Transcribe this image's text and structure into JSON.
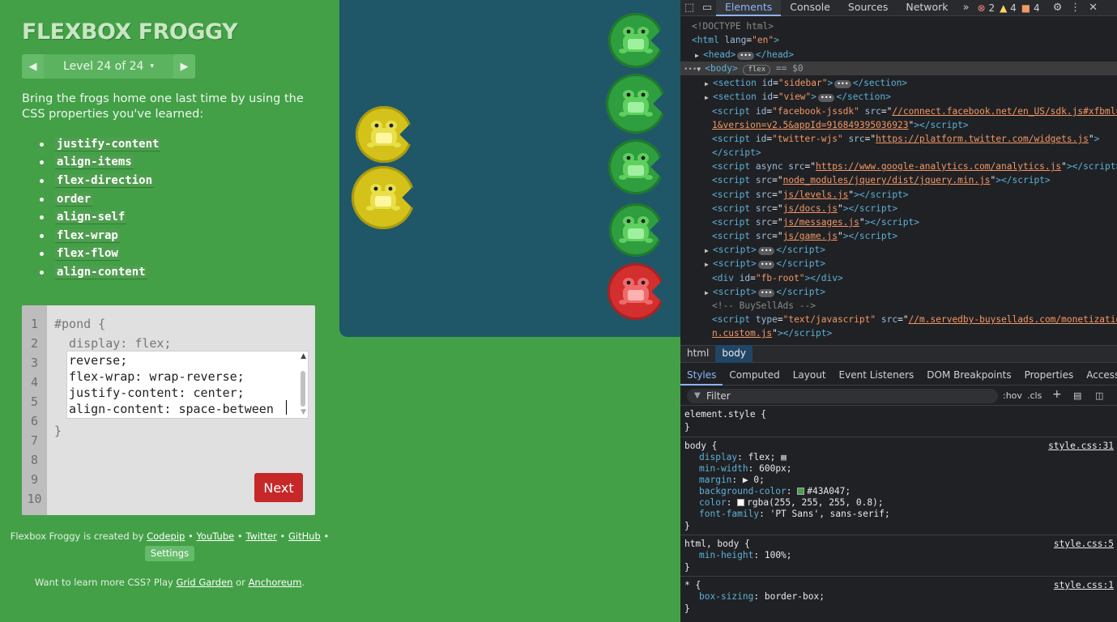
{
  "sidebar": {
    "logo": "FLEXBOX FROGGY",
    "level_label": "Level 24 of 24",
    "level_caret": "▾",
    "prev_arrow": "◀",
    "next_arrow": "▶",
    "instructions": "Bring the frogs home one last time by using the CSS properties you've learned:",
    "properties": [
      "justify-content",
      "align-items",
      "flex-direction",
      "order",
      "align-self",
      "flex-wrap",
      "flex-flow",
      "align-content"
    ]
  },
  "editor": {
    "line_numbers": [
      "1",
      "2",
      "3",
      "4",
      "5",
      "6",
      "7",
      "8",
      "9",
      "10"
    ],
    "line1": "#pond {",
    "line2": "  display: flex;",
    "closing": "}",
    "input_lines": [
      "reverse;",
      "flex-wrap: wrap-reverse;",
      "justify-content: center;",
      "align-content: space-between"
    ],
    "next_label": "Next"
  },
  "credits": {
    "prefix": "Flexbox Froggy is created by ",
    "codepip": "Codepip",
    "sep": " • ",
    "youtube": "YouTube",
    "twitter": "Twitter",
    "github": "GitHub",
    "settings": "Settings"
  },
  "promo": {
    "prefix": "Want to learn more CSS? Play ",
    "grid_garden": "Grid Garden",
    "or": " or ",
    "anchoreum": "Anchoreum",
    "suffix": "."
  },
  "pond": {
    "background": "#1f5768",
    "items": [
      {
        "color": "green",
        "frog": "green"
      },
      {
        "color": "green",
        "frog": "green"
      },
      {
        "color": "green",
        "frog": "green"
      },
      {
        "color": "green",
        "frog": "green"
      },
      {
        "color": "red",
        "frog": "red"
      },
      {
        "color": "yellow",
        "frog": "yellow"
      },
      {
        "color": "yellow",
        "frog": "yellow"
      }
    ]
  },
  "devtools": {
    "tabs": [
      "Elements",
      "Console",
      "Sources",
      "Network"
    ],
    "more": "»",
    "errors": "2",
    "warnings": "4",
    "issues": "4",
    "dom": {
      "doctype": "<!DOCTYPE html>",
      "html_open": "<html",
      "lang_attr": "lang",
      "lang_val": "\"en\"",
      "head": "<head>",
      "head_close": "</head>",
      "body": "<body>",
      "flex_badge": "flex",
      "eq": "== $0",
      "sidebar_id": "\"sidebar\"",
      "view_id": "\"view\"",
      "fb_id": "\"facebook-jssdk\"",
      "fb_src_1": "//connect.facebook.net/en_US/sdk.js#xfbml=",
      "fb_src_2": "1&version=v2.5&appId=916849395036923",
      "tw_id": "\"twitter-wjs\"",
      "tw_src": "https://platform.twitter.com/widgets.js",
      "ga_src": "https://www.google-analytics.com/analytics.js",
      "jq_src": "node_modules/jquery/dist/jquery.min.js",
      "levels_src": "js/levels.js",
      "docs_src": "js/docs.js",
      "messages_src": "js/messages.js",
      "game_src": "js/game.js",
      "fb_root": "\"fb-root\"",
      "comment": "<!-- BuySellAds -->",
      "type_val": "\"text/javascript\"",
      "bsa_src_1": "//m.servedby-buysellads.com/monetizatio",
      "bsa_src_2": "n.custom.js"
    },
    "breadcrumb": [
      "html",
      "body"
    ],
    "style_tabs": [
      "Styles",
      "Computed",
      "Layout",
      "Event Listeners",
      "DOM Breakpoints",
      "Properties",
      "Accessibility"
    ],
    "filter_placeholder": "Filter",
    "hov": ":hov",
    "cls": ".cls",
    "rules": {
      "element_style": "element.style {",
      "close": "}",
      "body_selector": "body {",
      "body_src": "style.css:31",
      "body_props": [
        {
          "name": "display",
          "value": "flex;"
        },
        {
          "name": "min-width",
          "value": "600px;"
        },
        {
          "name": "margin",
          "value": "▶ 0;"
        },
        {
          "name": "background-color",
          "value": "#43A047;"
        },
        {
          "name": "color",
          "value": "rgba(255, 255, 255, 0.8);"
        },
        {
          "name": "font-family",
          "value": "'PT Sans', sans-serif;"
        }
      ],
      "htmlbody_selector": "html, body {",
      "htmlbody_src": "style.css:5",
      "htmlbody_prop": {
        "name": "min-height",
        "value": "100%;"
      },
      "star_selector": "* {",
      "star_src": "style.css:1",
      "star_prop": {
        "name": "box-sizing",
        "value": "border-box;"
      }
    }
  },
  "colors": {
    "page_bg": "#43A047",
    "pond_bg": "#1f5768",
    "next_button": "#c62828",
    "devtools_bg": "#202124",
    "accent": "#8ab4f8"
  }
}
